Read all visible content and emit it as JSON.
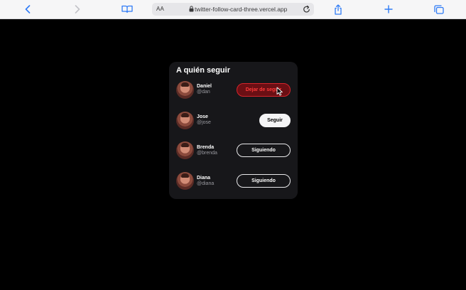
{
  "browser": {
    "reader_label": "AA",
    "url": "twitter-follow-card-three.vercel.app"
  },
  "card": {
    "title": "A quién seguir",
    "users": [
      {
        "name": "Daniel",
        "handle": "@dan",
        "button": "Dejar de seguir",
        "state": "hover-unfollow"
      },
      {
        "name": "Jose",
        "handle": "@jose",
        "button": "Seguir",
        "state": "not-following"
      },
      {
        "name": "Brenda",
        "handle": "@brenda",
        "button": "Siguiendo",
        "state": "following"
      },
      {
        "name": "Diana",
        "handle": "@diana",
        "button": "Siguiendo",
        "state": "following"
      }
    ]
  },
  "colors": {
    "accent": "#2f7bf6",
    "card_bg": "#17171a",
    "unfollow_text": "#ff3b3b",
    "unfollow_border": "#d8242b"
  }
}
